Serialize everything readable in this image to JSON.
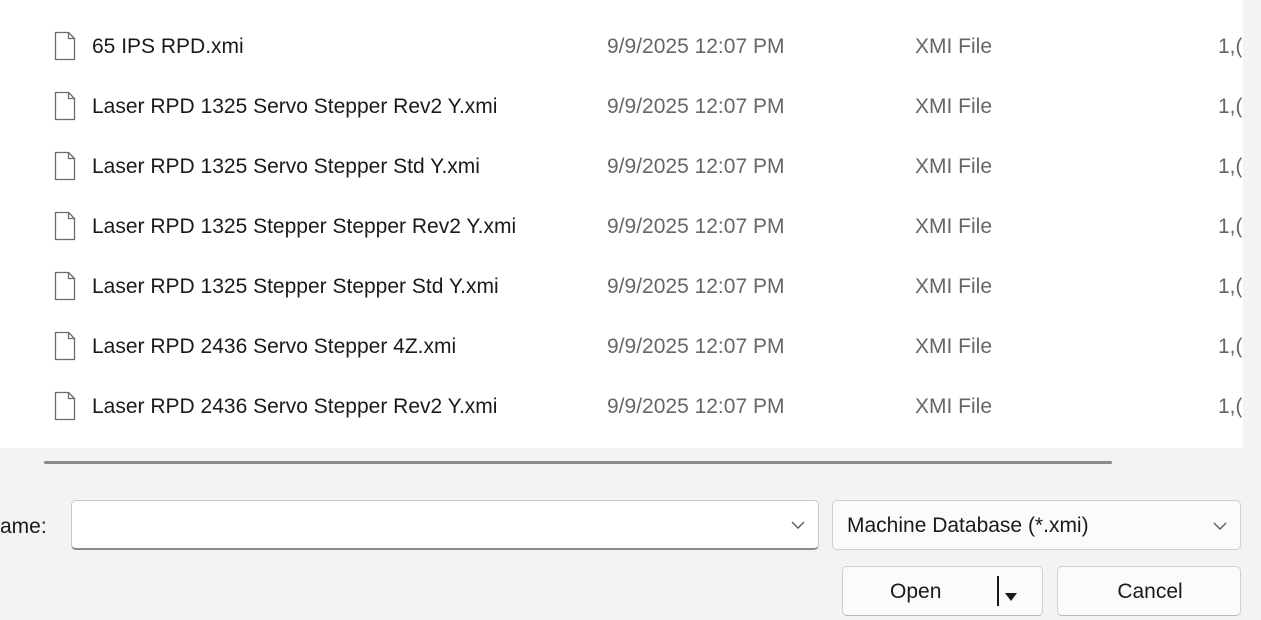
{
  "files": [
    {
      "name": "65 IPS RPD.xmi",
      "date": "9/9/2025 12:07 PM",
      "type": "XMI File",
      "size": "1,("
    },
    {
      "name": "Laser RPD 1325 Servo Stepper Rev2 Y.xmi",
      "date": "9/9/2025 12:07 PM",
      "type": "XMI File",
      "size": "1,("
    },
    {
      "name": "Laser RPD 1325 Servo Stepper Std Y.xmi",
      "date": "9/9/2025 12:07 PM",
      "type": "XMI File",
      "size": "1,("
    },
    {
      "name": "Laser RPD 1325 Stepper Stepper Rev2 Y.xmi",
      "date": "9/9/2025 12:07 PM",
      "type": "XMI File",
      "size": "1,("
    },
    {
      "name": "Laser RPD 1325 Stepper Stepper Std Y.xmi",
      "date": "9/9/2025 12:07 PM",
      "type": "XMI File",
      "size": "1,("
    },
    {
      "name": "Laser RPD 2436 Servo Stepper 4Z.xmi",
      "date": "9/9/2025 12:07 PM",
      "type": "XMI File",
      "size": "1,("
    },
    {
      "name": "Laser RPD 2436 Servo Stepper Rev2 Y.xmi",
      "date": "9/9/2025 12:07 PM",
      "type": "XMI File",
      "size": "1,("
    }
  ],
  "file_icon": "file-icon",
  "footer": {
    "name_label": "ame:",
    "name_value": "",
    "file_type_selected": "Machine Database (*.xmi)",
    "open_label": "Open",
    "cancel_label": "Cancel"
  },
  "colors": {
    "list_background": "#ffffff",
    "dialog_background": "#f3f3f3",
    "secondary_text": "#666666"
  }
}
